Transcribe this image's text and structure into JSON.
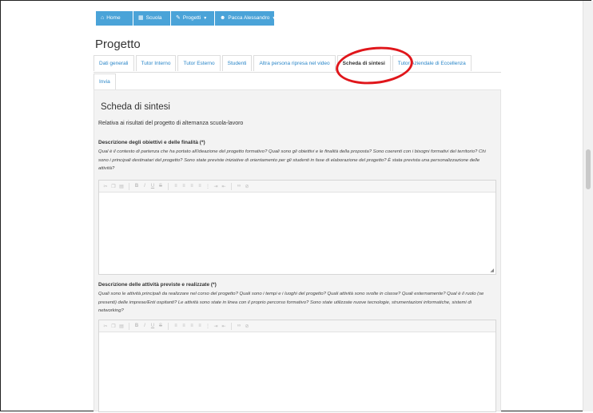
{
  "navbar": [
    {
      "label": "Home",
      "icon": "home-icon"
    },
    {
      "label": "Scuola",
      "icon": "building-icon"
    },
    {
      "label": "Progetti",
      "icon": "wrench-icon"
    },
    {
      "label": "Pacca Alessandro",
      "icon": "user-icon"
    }
  ],
  "page_title": "Progetto",
  "tabs": [
    {
      "label": "Dati generali",
      "active": false
    },
    {
      "label": "Tutor Interno",
      "active": false
    },
    {
      "label": "Tutor Esterno",
      "active": false
    },
    {
      "label": "Studenti",
      "active": false
    },
    {
      "label": "Altra persona ripresa nel video",
      "active": false
    },
    {
      "label": "Scheda di sintesi",
      "active": true
    },
    {
      "label": "Tutor Aziendale di Eccellenza",
      "active": false
    }
  ],
  "tabs_row2": [
    {
      "label": "Invia",
      "active": false
    }
  ],
  "panel": {
    "title": "Scheda di sintesi",
    "subtitle": "Relativa ai risultati del progetto di alternanza scuola-lavoro",
    "sections": [
      {
        "title": "Descrizione degli obiettivi e delle finalità (*)",
        "description": "Qual è il contesto di partenza che ha portato all'ideazione del progetto formativo? Quali sono gli obiettivi e le finalità della proposta? Sono coerenti con i bisogni formativi del territorio? Chi sono i principali destinatari del progetto? Sono state previste iniziative di orientamento per gli studenti in fase di elaborazione del progetto? È stata prevista una personalizzazione delle attività?"
      },
      {
        "title": "Descrizione delle attività previste e realizzate (*)",
        "description": "Quali sono le attività principali da realizzare nel corso del progetto? Quali sono i tempi e i luoghi del progetto? Quali attività sono svolte in classe? Quali esternamente? Qual è il ruolo (se presenti) delle imprese/Enti ospitanti? Le attività sono state in linea con il proprio percorso formativo? Sono state utilizzate nuove tecnologie, strumentazioni informatiche, sistemi di networking?"
      }
    ]
  },
  "annotation_color": "#e0161b",
  "accent_color": "#4aa3d8"
}
